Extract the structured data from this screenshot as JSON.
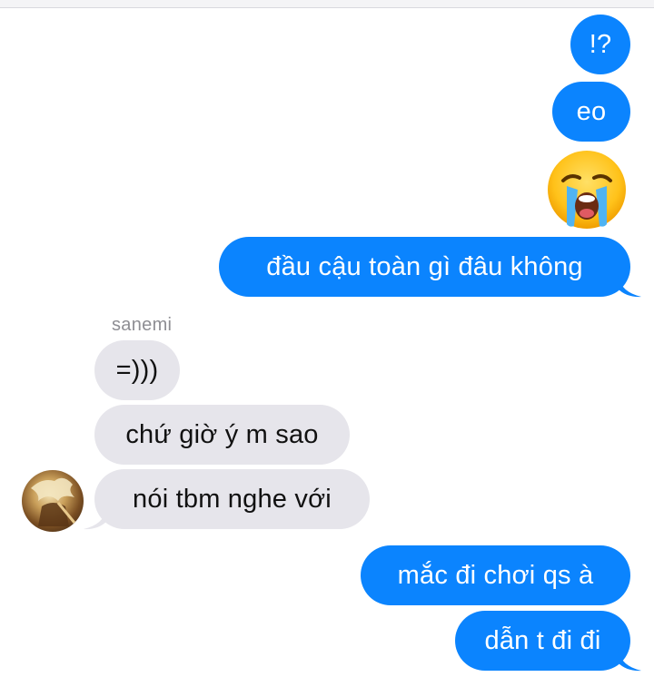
{
  "conversation": {
    "sender_name": "sanemi",
    "outgoing_top": [
      {
        "text": "!?"
      },
      {
        "text": "eo"
      },
      {
        "text": "đầu cậu toàn gì đâu không"
      }
    ],
    "incoming": [
      {
        "text": "=)))"
      },
      {
        "text": "chứ giờ ý m sao"
      },
      {
        "text": "nói tbm nghe với"
      }
    ],
    "outgoing_bottom": [
      {
        "text": "mắc đi chơi qs à"
      },
      {
        "text": "dẫn t đi đi"
      }
    ],
    "emoji": "loudly-crying-face"
  },
  "colors": {
    "outgoing_bubble": "#0b84fe",
    "incoming_bubble": "#e6e5eb",
    "sender_name": "#8e8e93",
    "background": "#ffffff"
  }
}
